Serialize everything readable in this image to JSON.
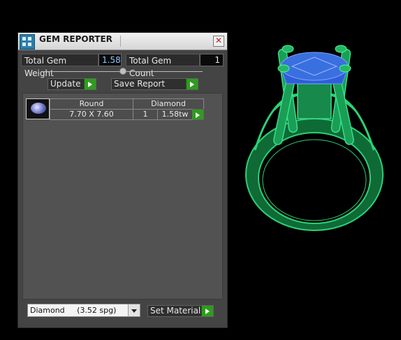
{
  "window": {
    "title": "GEM REPORTER",
    "close_glyph": "✕"
  },
  "totals": {
    "weight_label": "Total Gem Weight",
    "weight_value": "1.58",
    "count_label": "Total Gem Count",
    "count_value": "1"
  },
  "buttons": {
    "update_label": "Update",
    "save_report_label": "Save Report",
    "set_material_label": "Set Material"
  },
  "gem_list": [
    {
      "thumbnail_icon": "gem-round-icon",
      "shape": "Round",
      "size": "7.70 X 7.60",
      "material": "Diamond",
      "count": "1",
      "weight": "1.58tw"
    }
  ],
  "material_select": {
    "selected": "Diamond     (3.52 spg)"
  },
  "colors": {
    "panel_bg": "#444444",
    "accent_green": "#2e9c1e",
    "value_blue": "#8fc7ff",
    "ring_green": "#1ea35a",
    "stone_blue": "#3a6fe0"
  },
  "viewport": {
    "object_icon": "ring-3d-model-icon"
  }
}
